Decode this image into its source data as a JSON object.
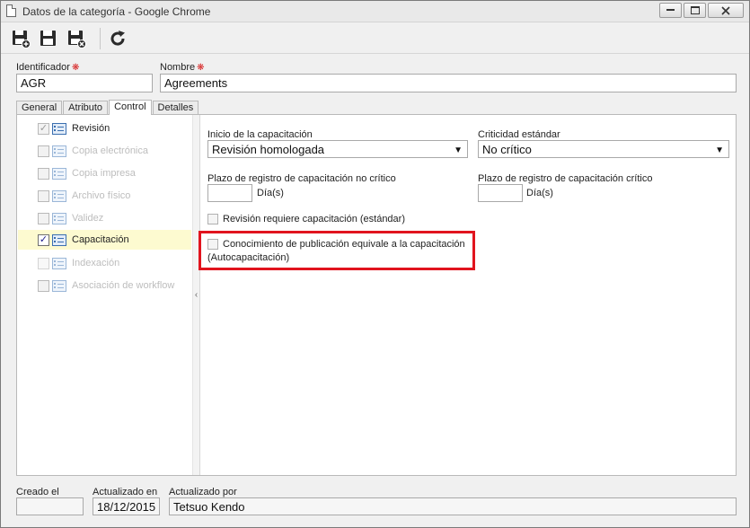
{
  "window": {
    "title": "Datos de la categoría - Google Chrome",
    "buttons": [
      "minimize",
      "maximize",
      "close"
    ]
  },
  "toolbar": {
    "buttons": [
      {
        "name": "save-new-icon"
      },
      {
        "name": "save-icon"
      },
      {
        "name": "save-close-icon"
      },
      {
        "name": "refresh-icon"
      }
    ]
  },
  "header": {
    "identifier_label": "Identificador",
    "identifier_value": "AGR",
    "name_label": "Nombre",
    "name_value": "Agreements",
    "required_mark": "❋"
  },
  "tabs": [
    {
      "label": "General",
      "active": false
    },
    {
      "label": "Atributo",
      "active": false
    },
    {
      "label": "Control",
      "active": true
    },
    {
      "label": "Detalles",
      "active": false
    }
  ],
  "left_list": {
    "items": [
      {
        "label": "Revisión",
        "checked": true,
        "enabled": true,
        "selected": false
      },
      {
        "label": "Copia electrónica",
        "checked": false,
        "enabled": false,
        "selected": false
      },
      {
        "label": "Copia impresa",
        "checked": false,
        "enabled": false,
        "selected": false
      },
      {
        "label": "Archivo físico",
        "checked": false,
        "enabled": false,
        "selected": false
      },
      {
        "label": "Validez",
        "checked": false,
        "enabled": false,
        "selected": false
      },
      {
        "label": "Capacitación",
        "checked": true,
        "enabled": true,
        "selected": true
      },
      {
        "label": "Indexación",
        "checked": false,
        "enabled": false,
        "selected": false
      },
      {
        "label": "Asociación de workflow",
        "checked": false,
        "enabled": false,
        "selected": false
      }
    ]
  },
  "form": {
    "start_label": "Inicio de la capacitación",
    "start_value": "Revisión homologada",
    "criticality_label": "Criticidad estándar",
    "criticality_value": "No crítico",
    "noncritical_period_label": "Plazo de registro de capacitación no crítico",
    "noncritical_period_value": "",
    "critical_period_label": "Plazo de registro de capacitación crítico",
    "critical_period_value": "",
    "days_unit": "Día(s)",
    "revision_requires_label": "Revisión requiere capacitación (estándar)",
    "revision_requires_checked": false,
    "knowledge_label_line1": "Conocimiento de publicación equivale a la capacitación",
    "knowledge_label_line2": "(Autocapacitación)",
    "knowledge_checked": false
  },
  "footer": {
    "created_label": "Creado el",
    "created_value": "",
    "updated_label": "Actualizado en",
    "updated_value": "18/12/2015",
    "updated_by_label": "Actualizado por",
    "updated_by_value": "Tetsuo Kendo"
  },
  "colors": {
    "highlight_border": "#e1141e",
    "selected_row": "#fdfad0"
  }
}
